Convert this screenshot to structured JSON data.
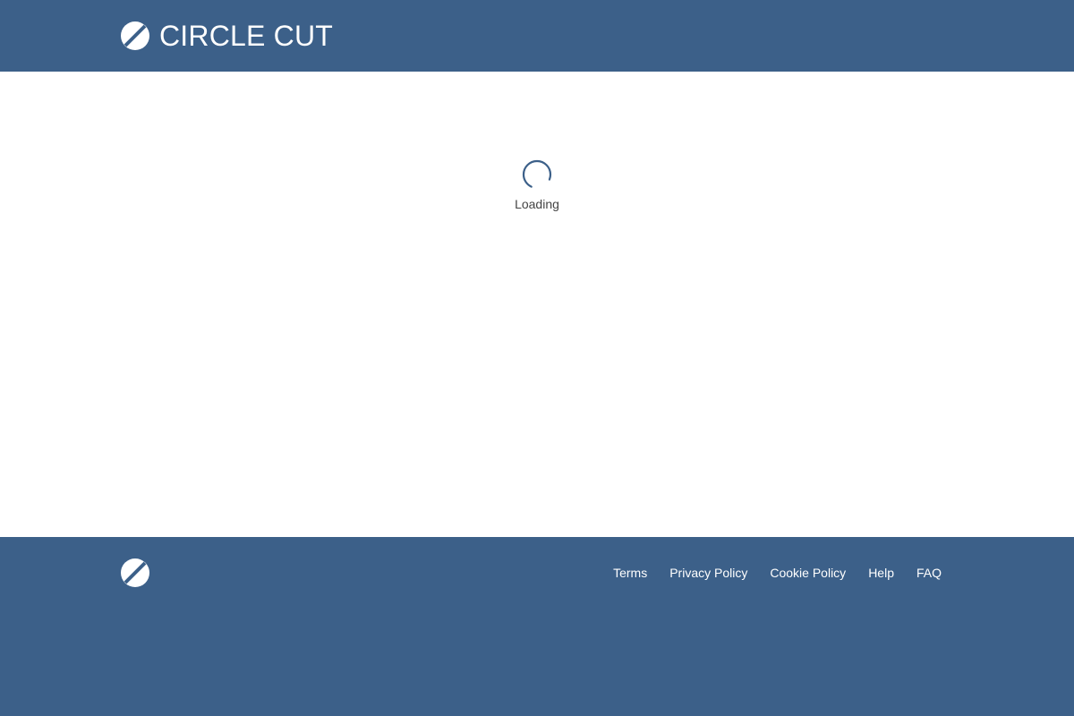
{
  "colors": {
    "brand": "#3c6089",
    "background": "#ffffff",
    "text_muted": "#444444"
  },
  "header": {
    "logo_icon": "circle-cut-logo-icon",
    "brand_name": "CIRCLE CUT"
  },
  "main": {
    "loading_icon": "spinner-icon",
    "loading_text": "Loading"
  },
  "footer": {
    "logo_icon": "circle-cut-logo-icon",
    "links": [
      {
        "label": "Terms"
      },
      {
        "label": "Privacy Policy"
      },
      {
        "label": "Cookie Policy"
      },
      {
        "label": "Help"
      },
      {
        "label": "FAQ"
      }
    ]
  }
}
